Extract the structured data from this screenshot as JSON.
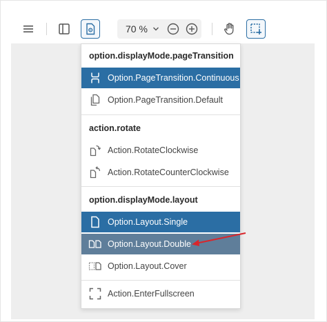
{
  "toolbar": {
    "zoom_value": "70 %",
    "icons": [
      "hamburger-icon",
      "sidebar-icon",
      "view-mode-icon",
      "chevron-down-icon",
      "zoom-out-icon",
      "zoom-in-icon",
      "hand-tool-icon",
      "selection-tool-icon"
    ]
  },
  "menu": {
    "sections": [
      {
        "header": "option.displayMode.pageTransition",
        "items": [
          {
            "label": "Option.PageTransition.Continuous",
            "icon": "continuous-scroll-icon",
            "state": "selected"
          },
          {
            "label": "Option.PageTransition.Default",
            "icon": "pages-icon",
            "state": "normal"
          }
        ]
      },
      {
        "header": "action.rotate",
        "items": [
          {
            "label": "Action.RotateClockwise",
            "icon": "rotate-clockwise-icon",
            "state": "normal"
          },
          {
            "label": "Action.RotateCounterClockwise",
            "icon": "rotate-counterclockwise-icon",
            "state": "normal"
          }
        ]
      },
      {
        "header": "option.displayMode.layout",
        "items": [
          {
            "label": "Option.Layout.Single",
            "icon": "single-page-icon",
            "state": "selected"
          },
          {
            "label": "Option.Layout.Double",
            "icon": "double-page-icon",
            "state": "hovered"
          },
          {
            "label": "Option.Layout.Cover",
            "icon": "cover-layout-icon",
            "state": "normal"
          }
        ]
      }
    ],
    "fullscreen": {
      "label": "Action.EnterFullscreen",
      "icon": "fullscreen-icon"
    }
  },
  "colors": {
    "accent": "#2b6ea4",
    "hover": "#5f7e9a",
    "annotation_arrow": "#d9262c"
  }
}
